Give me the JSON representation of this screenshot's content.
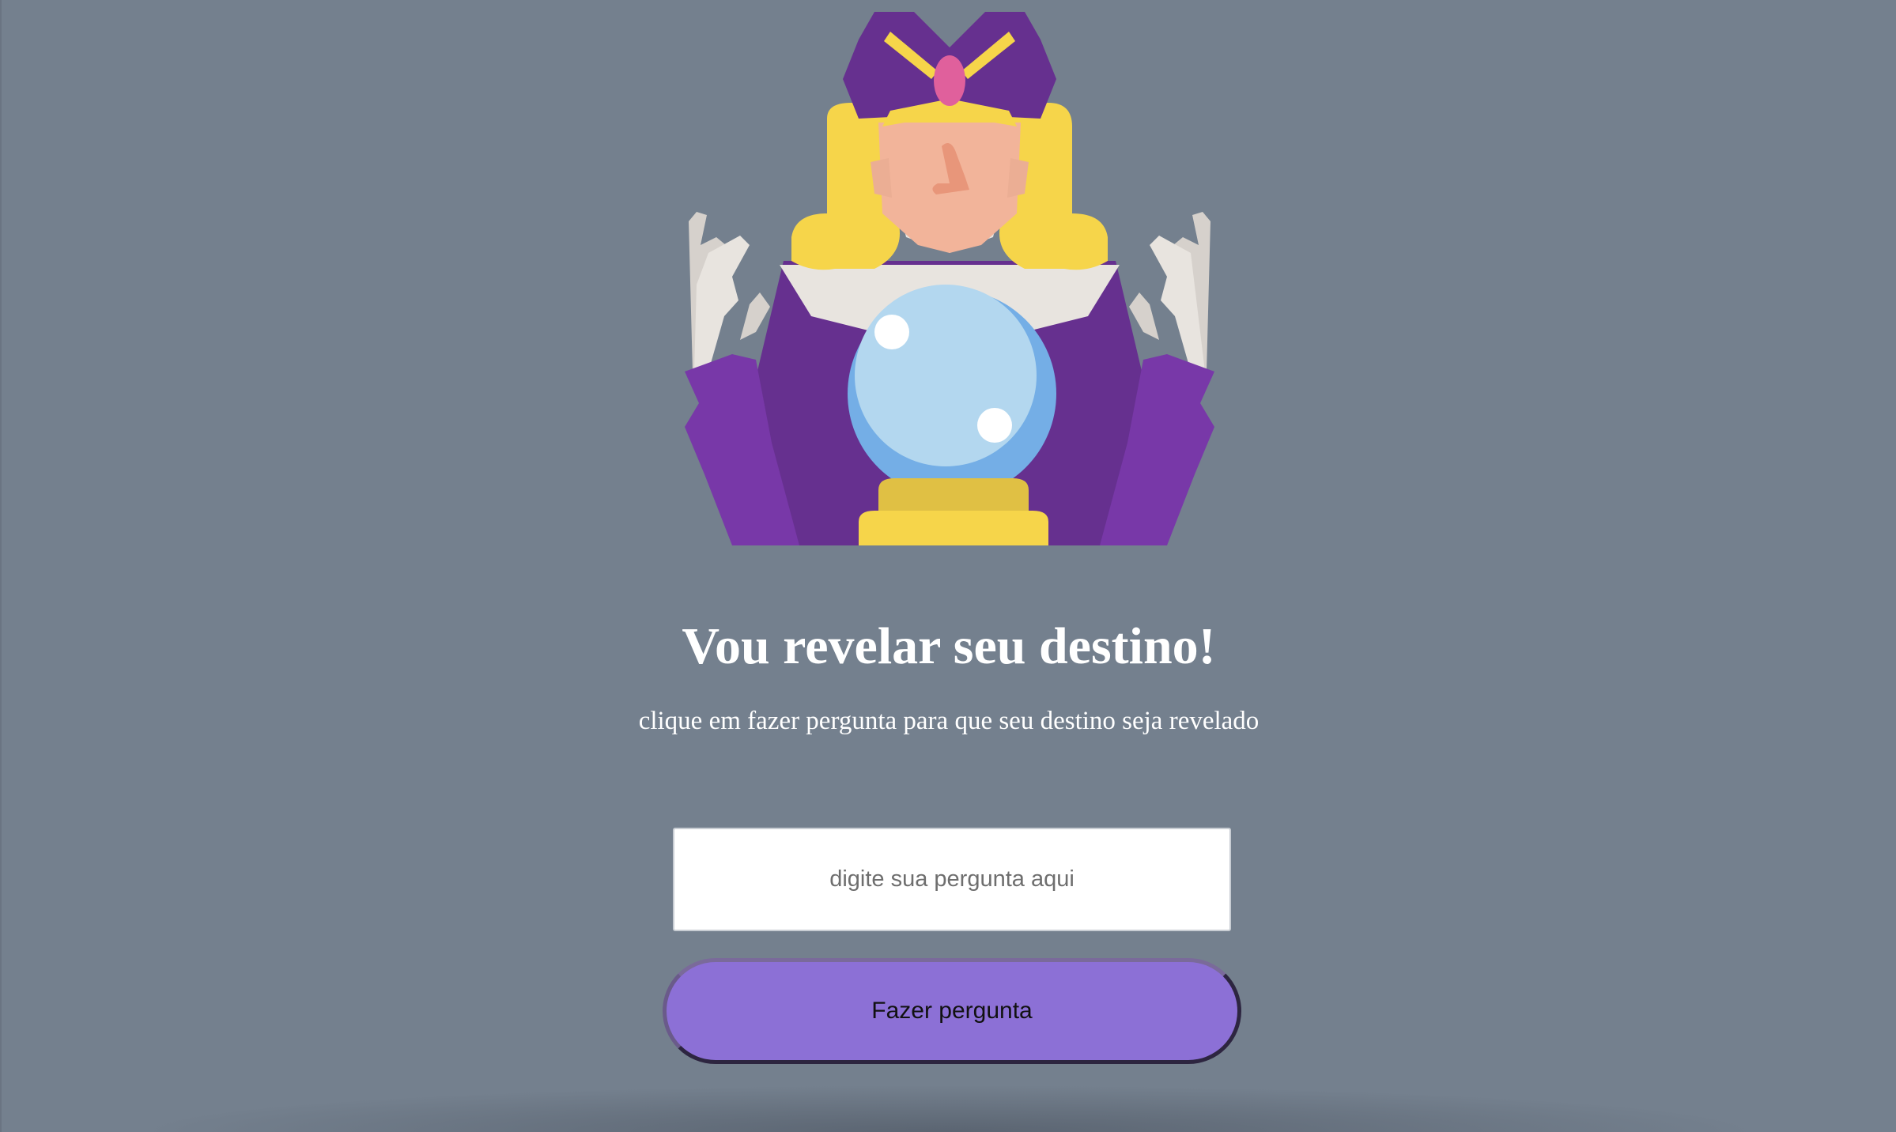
{
  "header": {
    "title": "Vou revelar seu destino!",
    "subtitle": "clique em fazer pergunta para que seu destino seja revelado"
  },
  "form": {
    "question_placeholder": "digite sua pergunta aqui",
    "question_value": "",
    "ask_button_label": "Fazer pergunta"
  },
  "illustration": {
    "icon": "fortune-teller-with-crystal-ball"
  },
  "colors": {
    "background": "#74808e",
    "button": "#8c70d6",
    "robe_purple": "#66308f",
    "sleeve_purple": "#7838a8",
    "hair_yellow": "#f6d54a",
    "crystal_ball": "#74aee6",
    "skin": "#f2b49a",
    "gem_pink": "#e0609c"
  }
}
